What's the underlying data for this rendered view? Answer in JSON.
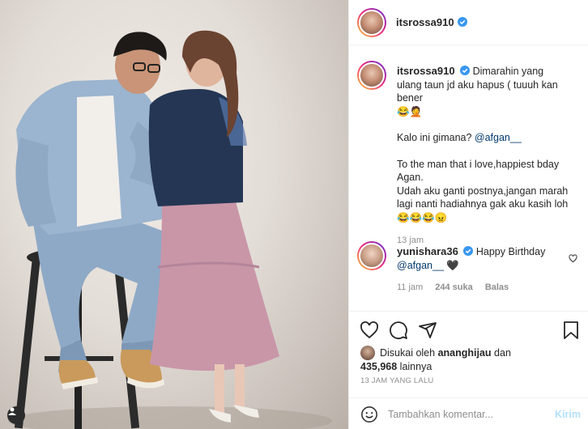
{
  "post": {
    "username": "itsrossa910",
    "caption": {
      "username": "itsrossa910",
      "line1": "Dimarahin yang ulang taun jd aku hapus ( tuuuh kan bener",
      "line1_emoji": "😂🤦",
      "line2_prefix": "Kalo ini gimana? ",
      "line2_mention": "@afgan__",
      "line3": "To the man that i love,happiest bday Agan.",
      "line4": "Udah aku ganti postnya,jangan marah lagi nanti hadiahnya gak aku kasih loh",
      "line4_emoji": "😂😂😂😠",
      "time": "13 jam"
    },
    "comment": {
      "username": "yunishara36",
      "text": "Happy Birthday",
      "mention": "@afgan__",
      "heart": "🖤",
      "time": "11 jam",
      "likes": "244 suka",
      "reply": "Balas"
    },
    "likes": {
      "prefix": "Disukai oleh ",
      "by": "ananghijau",
      "and": " dan",
      "count": "435,968",
      "suffix": " lainnya"
    },
    "time_ago": "13 JAM YANG LALU",
    "add_comment": {
      "placeholder": "Tambahkan komentar...",
      "post_label": "Kirim"
    }
  },
  "colors": {
    "verified": "#3897f0",
    "mention": "#00376b",
    "muted": "#8e8e8e",
    "post_disabled": "#b2dffc"
  },
  "icons": [
    "verified-badge-icon",
    "heart-icon",
    "comment-icon",
    "share-icon",
    "bookmark-icon",
    "emoji-icon",
    "user-tag-icon"
  ]
}
